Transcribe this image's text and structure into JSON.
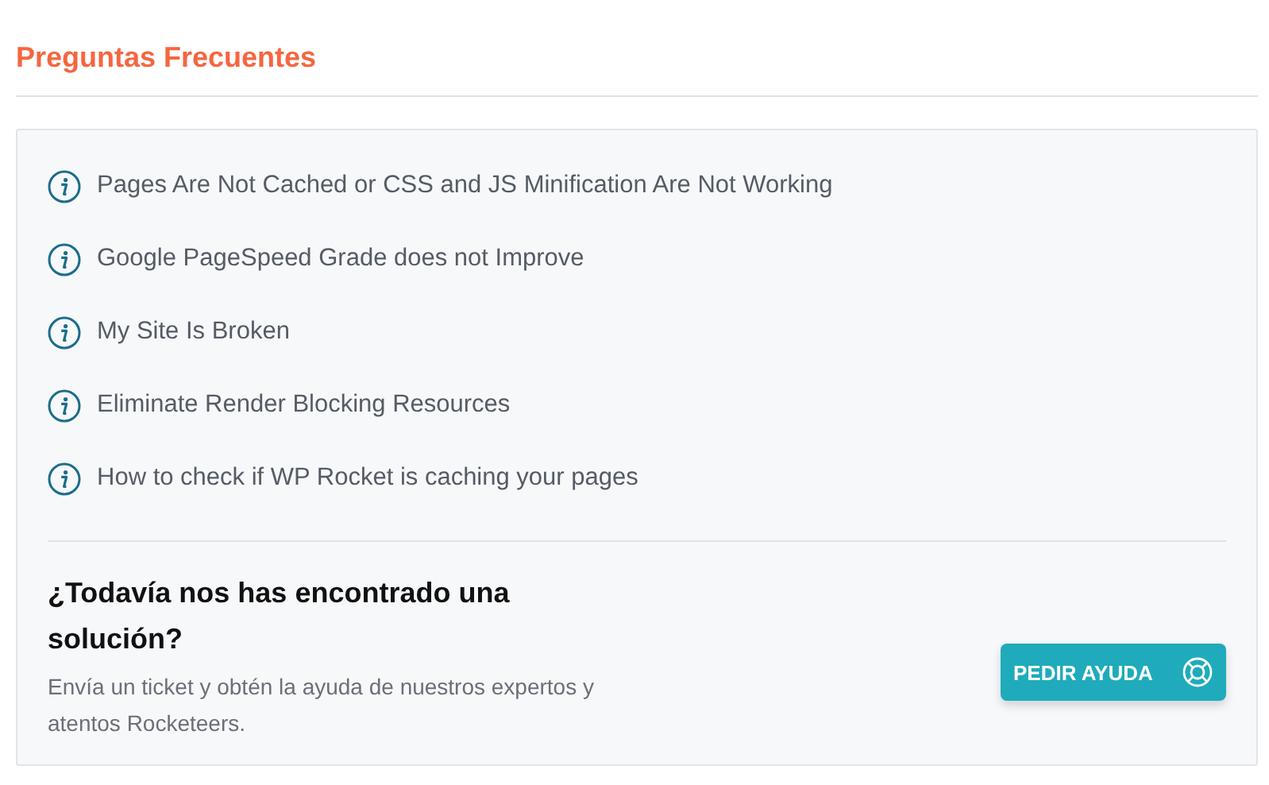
{
  "section_title": "Preguntas Frecuentes",
  "faq_items": [
    {
      "label": "Pages Are Not Cached or CSS and JS Minification Are Not Working"
    },
    {
      "label": "Google PageSpeed Grade does not Improve"
    },
    {
      "label": "My Site Is Broken"
    },
    {
      "label": "Eliminate Render Blocking Resources"
    },
    {
      "label": "How to check if WP Rocket is caching your pages"
    }
  ],
  "help": {
    "title": "¿Todavía nos has encontrado una solución?",
    "description": "Envía un ticket y obtén la ayuda de nuestros expertos y atentos Rocketeers.",
    "button": "PEDIR AYUDA"
  }
}
